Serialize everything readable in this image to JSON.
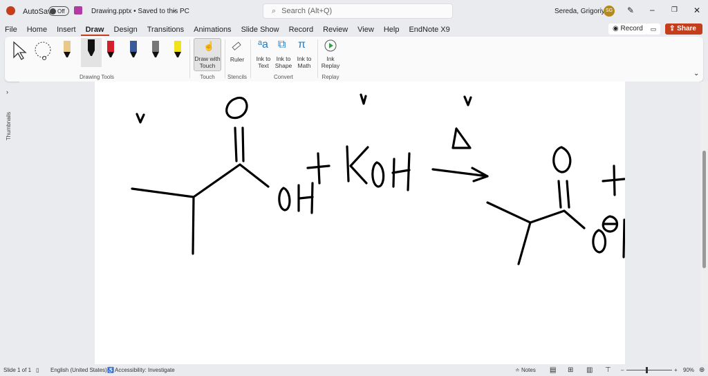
{
  "titlebar": {
    "autosave_label": "AutoSave",
    "autosave_state": "Off",
    "file_title": "Drawing.pptx • Saved to this PC",
    "search_placeholder": "Search (Alt+Q)",
    "user_name": "Sereda, Grigoriy A",
    "user_initials": "SG"
  },
  "menu": {
    "tabs": [
      "File",
      "Home",
      "Insert",
      "Draw",
      "Design",
      "Transitions",
      "Animations",
      "Slide Show",
      "Record",
      "Review",
      "View",
      "Help",
      "EndNote X9"
    ],
    "active": "Draw",
    "record_label": "Record",
    "share_label": "Share"
  },
  "ribbon": {
    "groups": {
      "drawing_tools": "Drawing Tools",
      "touch": "Touch",
      "stencils": "Stencils",
      "convert": "Convert",
      "replay": "Replay"
    },
    "buttons": {
      "draw_with_touch": "Draw with Touch",
      "ruler": "Ruler",
      "ink_to_text": "Ink to Text",
      "ink_to_shape": "Ink to Shape",
      "ink_to_math": "Ink to Math",
      "ink_replay": "Ink Replay"
    },
    "pen_colors": [
      "#e8c98a",
      "#111111",
      "#d3202a",
      "#3a5a9a",
      "#777777",
      "#f2e21b"
    ]
  },
  "sidepane": {
    "label": "Thumbnails"
  },
  "status": {
    "slide": "Slide 1 of 1",
    "language": "English (United States)",
    "accessibility": "Accessibility: Investigate",
    "notes": "Notes",
    "zoom": "90%"
  },
  "colors": {
    "accent": "#c43e1c",
    "ink": "#000000"
  }
}
